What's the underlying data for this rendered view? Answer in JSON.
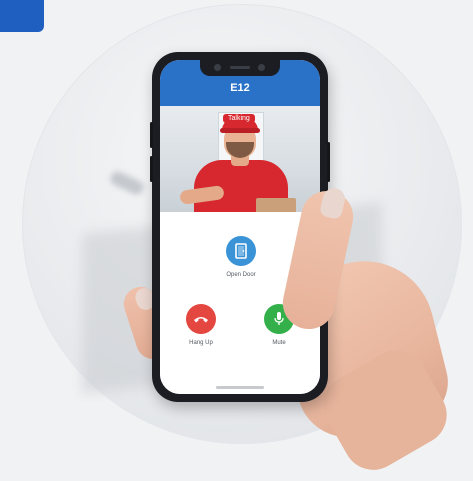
{
  "colors": {
    "topbar": "#2a72c8",
    "open_door": "#3a93d6",
    "hang_up": "#e3473f",
    "mute": "#33b04a"
  },
  "phone": {
    "title": "E12",
    "video": {
      "badge": "Talking"
    }
  },
  "controls": {
    "open_door": {
      "label": "Open Door",
      "icon": "door-icon"
    },
    "hang_up": {
      "label": "Hang Up",
      "icon": "phone-hangup-icon"
    },
    "mute": {
      "label": "Mute",
      "icon": "microphone-icon"
    }
  }
}
